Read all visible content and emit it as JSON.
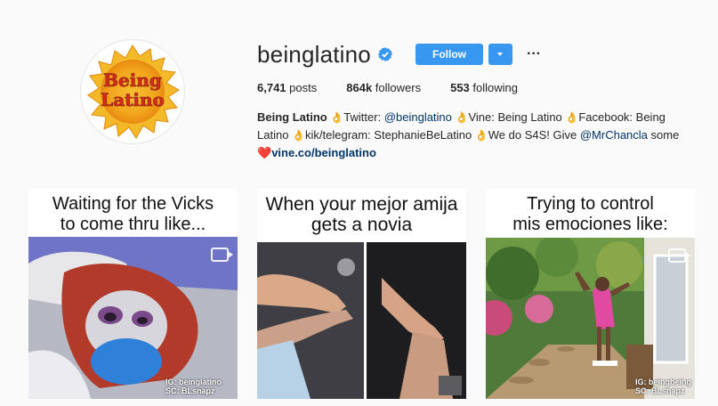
{
  "profile": {
    "username": "beinglatino",
    "verified": true,
    "avatar_text": [
      "Being",
      "Latino"
    ],
    "follow_label": "Follow",
    "more_label": "···",
    "stats": {
      "posts_count": "6,741",
      "posts_label": "posts",
      "followers_count": "864k",
      "followers_label": "followers",
      "following_count": "553",
      "following_label": "following"
    },
    "bio": {
      "name": "Being Latino",
      "seg1": "Twitter: ",
      "twitter_handle": "@beinglatino",
      "seg2": "Vine: Being Latino ",
      "seg3": "Facebook: Being Latino ",
      "seg4": "kik/telegram: StephanieBeLatino ",
      "seg5": "We do S4S! Give ",
      "mention2": "@MrChancla",
      "seg6": " some",
      "link": "vine.co/beinglatino",
      "emoji_hand": "👌",
      "emoji_heart": "❤️"
    }
  },
  "posts": [
    {
      "caption_line1": "Waiting for the Vicks",
      "caption_line2": "to come thru like...",
      "watermark_line1": "IG: beinglatino",
      "watermark_line2": "SC: BLsnapz"
    },
    {
      "caption_line1": "When your mejor amija",
      "caption_line2": "gets a novia"
    },
    {
      "caption_line1": "Trying to control",
      "caption_line2": "mis emociones like:",
      "watermark_line1": "IG: beingbeing",
      "watermark_line2": "SC: BLsnapz"
    }
  ],
  "colors": {
    "accent": "#3897f0",
    "link": "#003569",
    "background": "#fafafa"
  },
  "icons": {
    "verified": "verified-badge-icon",
    "dropdown": "chevron-down-icon",
    "video": "video-icon"
  }
}
